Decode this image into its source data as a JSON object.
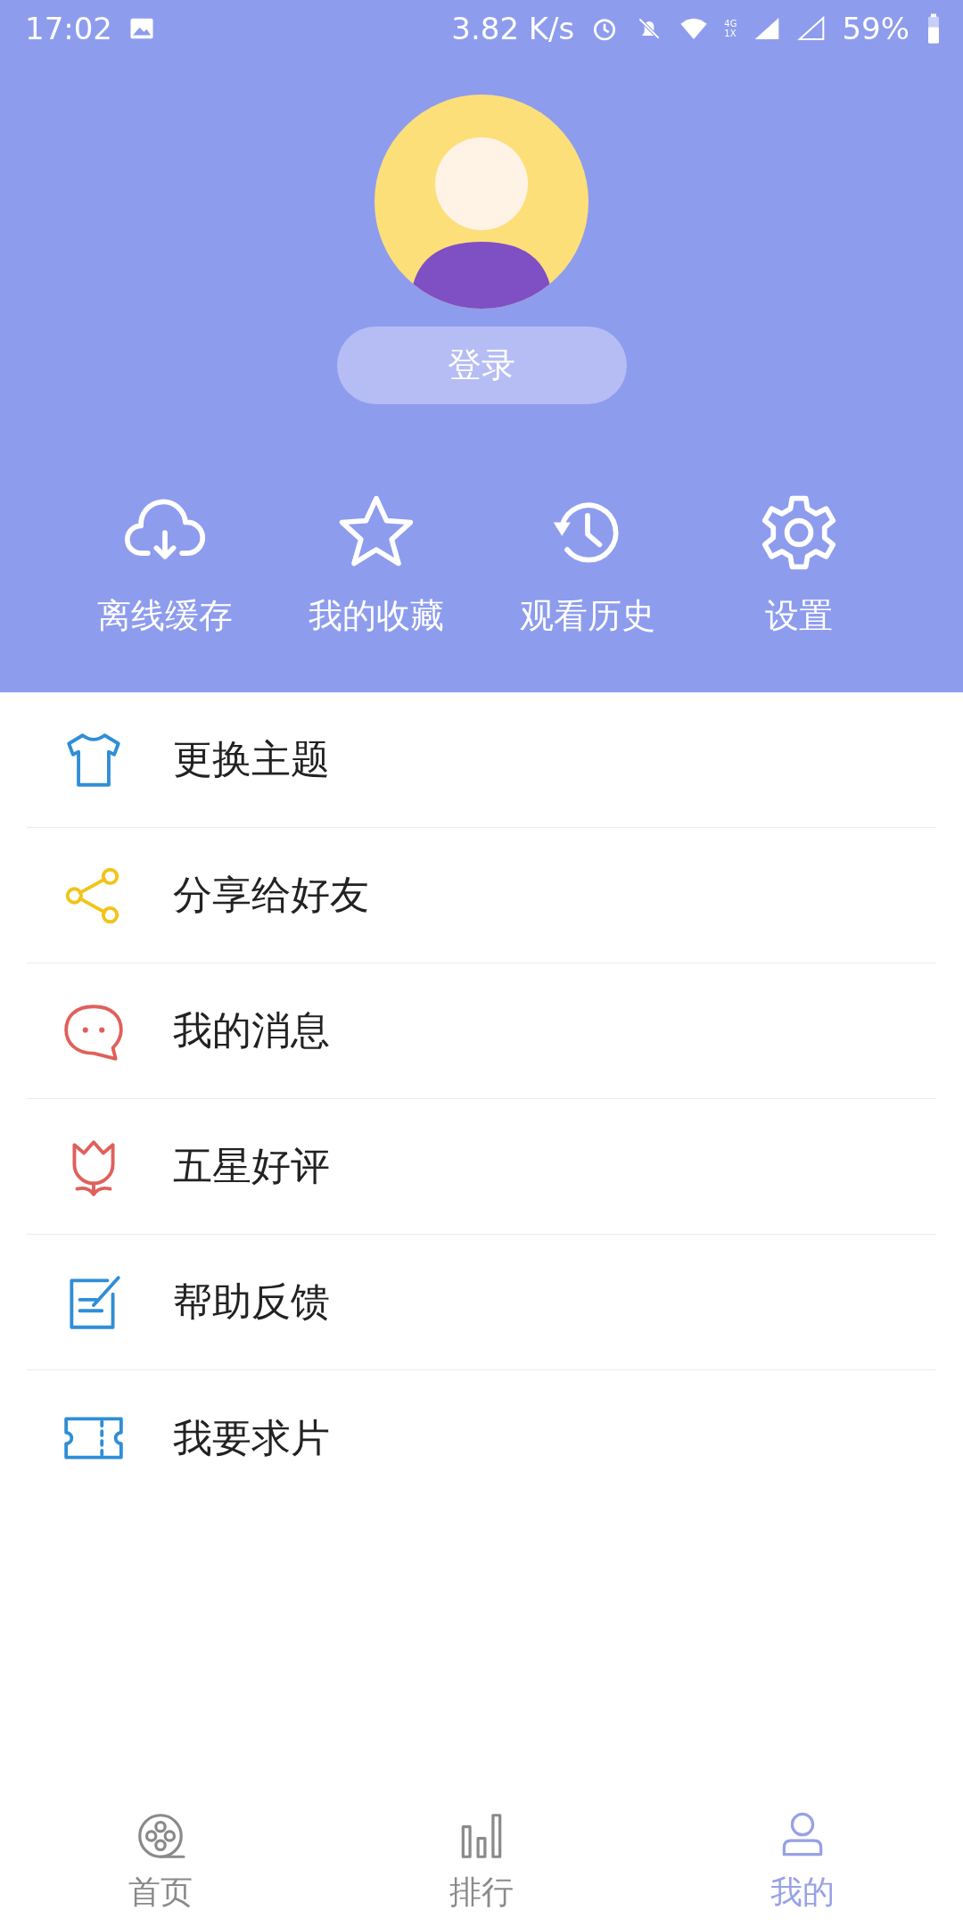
{
  "status_bar": {
    "time": "17:02",
    "speed": "3.82 K/s",
    "network_top": "4G",
    "network_bottom": "1X",
    "battery": "59%"
  },
  "profile": {
    "login_button": "登录"
  },
  "quick_actions": [
    {
      "kind": "cloud",
      "label": "离线缓存"
    },
    {
      "kind": "star",
      "label": "我的收藏"
    },
    {
      "kind": "history",
      "label": "观看历史"
    },
    {
      "kind": "gear",
      "label": "设置"
    }
  ],
  "menu": [
    {
      "kind": "shirt",
      "label": "更换主题",
      "color": "#2f8ed6"
    },
    {
      "kind": "share",
      "label": "分享给好友",
      "color": "#f1c419"
    },
    {
      "kind": "chat",
      "label": "我的消息",
      "color": "#e0605a"
    },
    {
      "kind": "tulip",
      "label": "五星好评",
      "color": "#e0605a"
    },
    {
      "kind": "edit",
      "label": "帮助反馈",
      "color": "#2f8ed6"
    },
    {
      "kind": "ticket",
      "label": "我要求片",
      "color": "#2f8ed6"
    }
  ],
  "bottom_nav": [
    {
      "kind": "film",
      "label": "首页",
      "selected": false
    },
    {
      "kind": "bars",
      "label": "排行",
      "selected": false
    },
    {
      "kind": "person",
      "label": "我的",
      "selected": true
    }
  ]
}
